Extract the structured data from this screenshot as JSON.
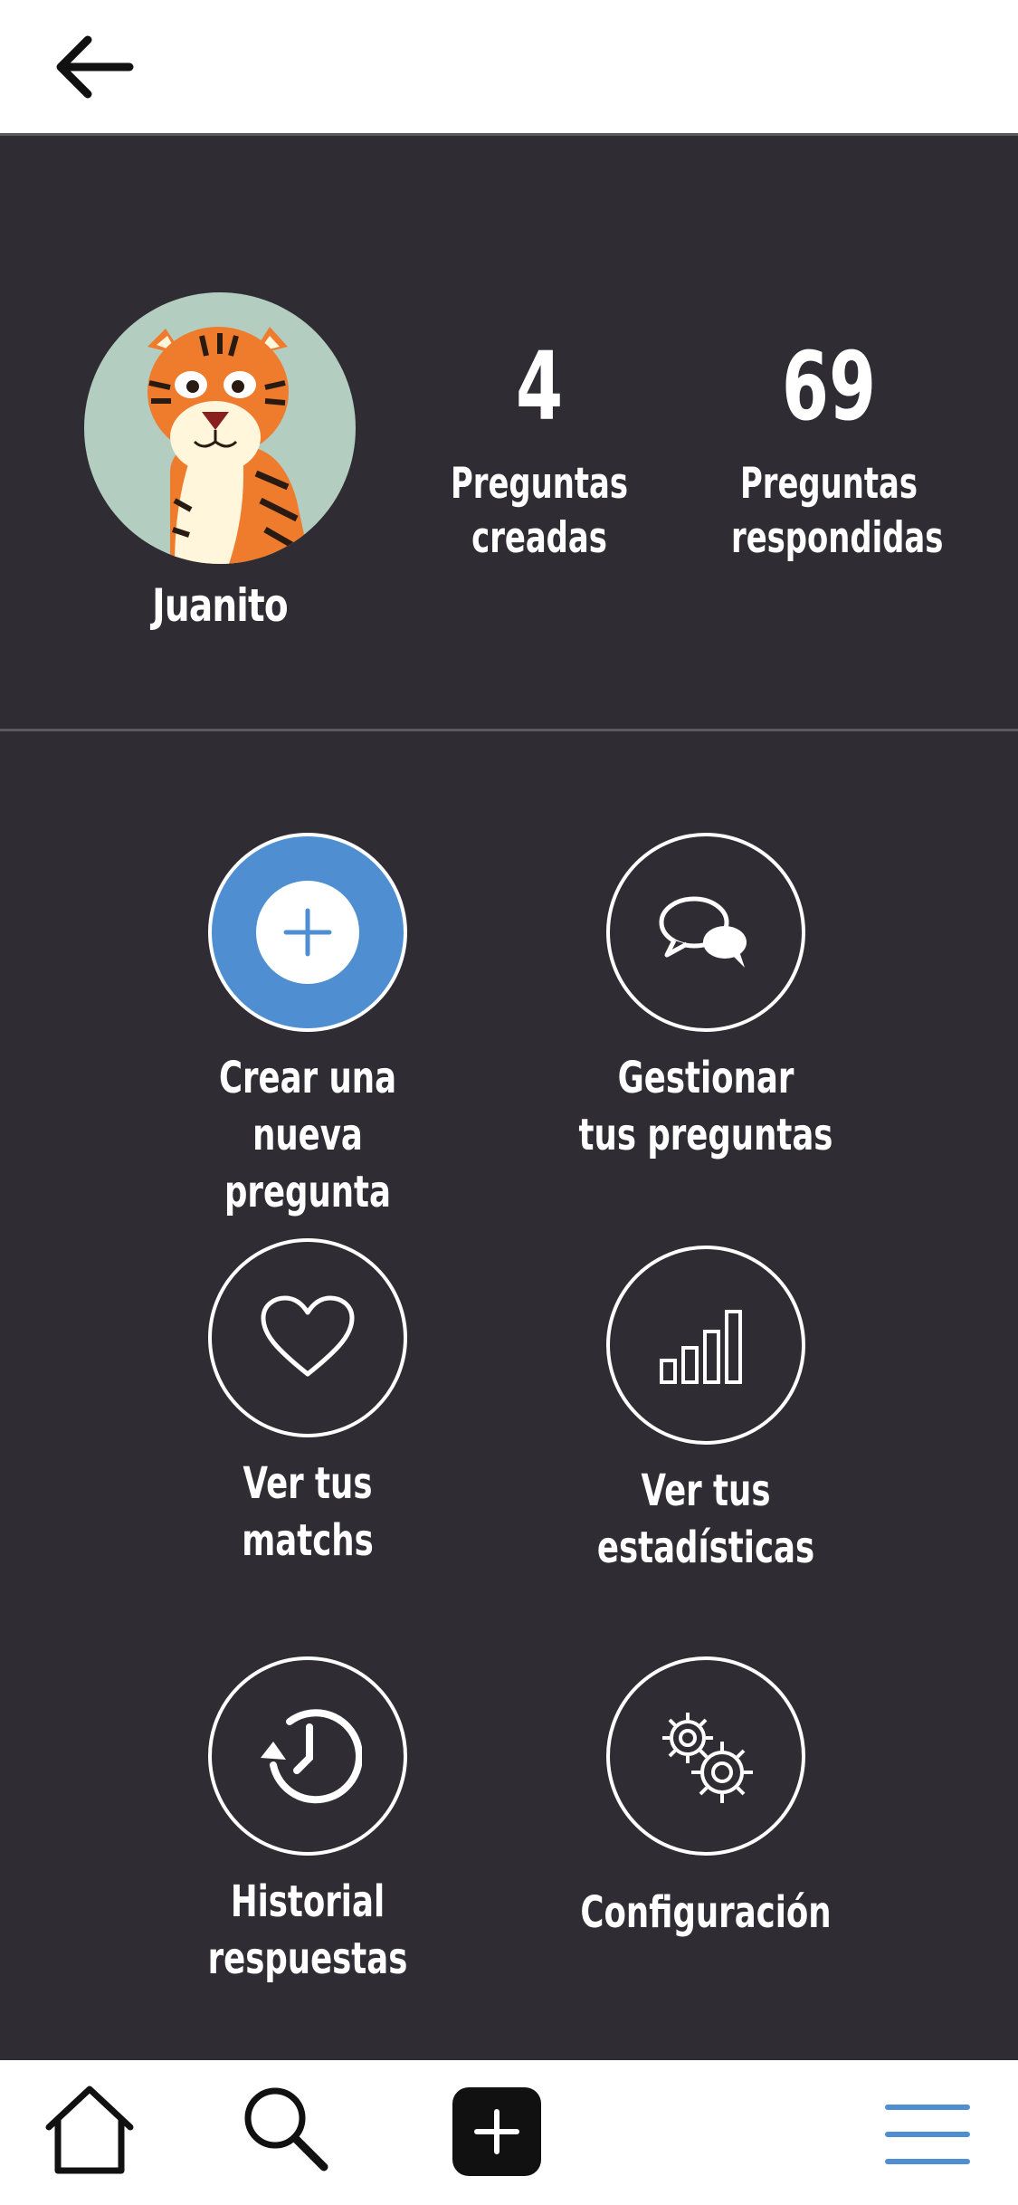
{
  "header": {
    "back_icon": "arrow-left-icon"
  },
  "profile": {
    "username": "Juanito",
    "avatar_icon": "tiger-avatar",
    "stats": [
      {
        "value": "4",
        "label": "Preguntas\ncreadas"
      },
      {
        "value": "69",
        "label": "Preguntas\nrespondidas"
      }
    ]
  },
  "actions": [
    {
      "label": "Crear una\nnueva pregunta",
      "icon": "plus-icon"
    },
    {
      "label": "Gestionar\ntus preguntas",
      "icon": "chat-bubbles-icon"
    },
    {
      "label": "Ver tus\nmatchs",
      "icon": "heart-icon"
    },
    {
      "label": "Ver tus\nestadísticas",
      "icon": "bar-chart-icon"
    },
    {
      "label": "Historial\nrespuestas",
      "icon": "history-icon"
    },
    {
      "label": "Configuración",
      "icon": "gears-icon"
    }
  ],
  "bottom_nav": {
    "items": [
      "home-icon",
      "search-icon",
      "add-icon",
      "menu-icon"
    ]
  },
  "colors": {
    "background": "#2f2d33",
    "accent": "#4f8fd1",
    "bar": "#ffffff"
  }
}
